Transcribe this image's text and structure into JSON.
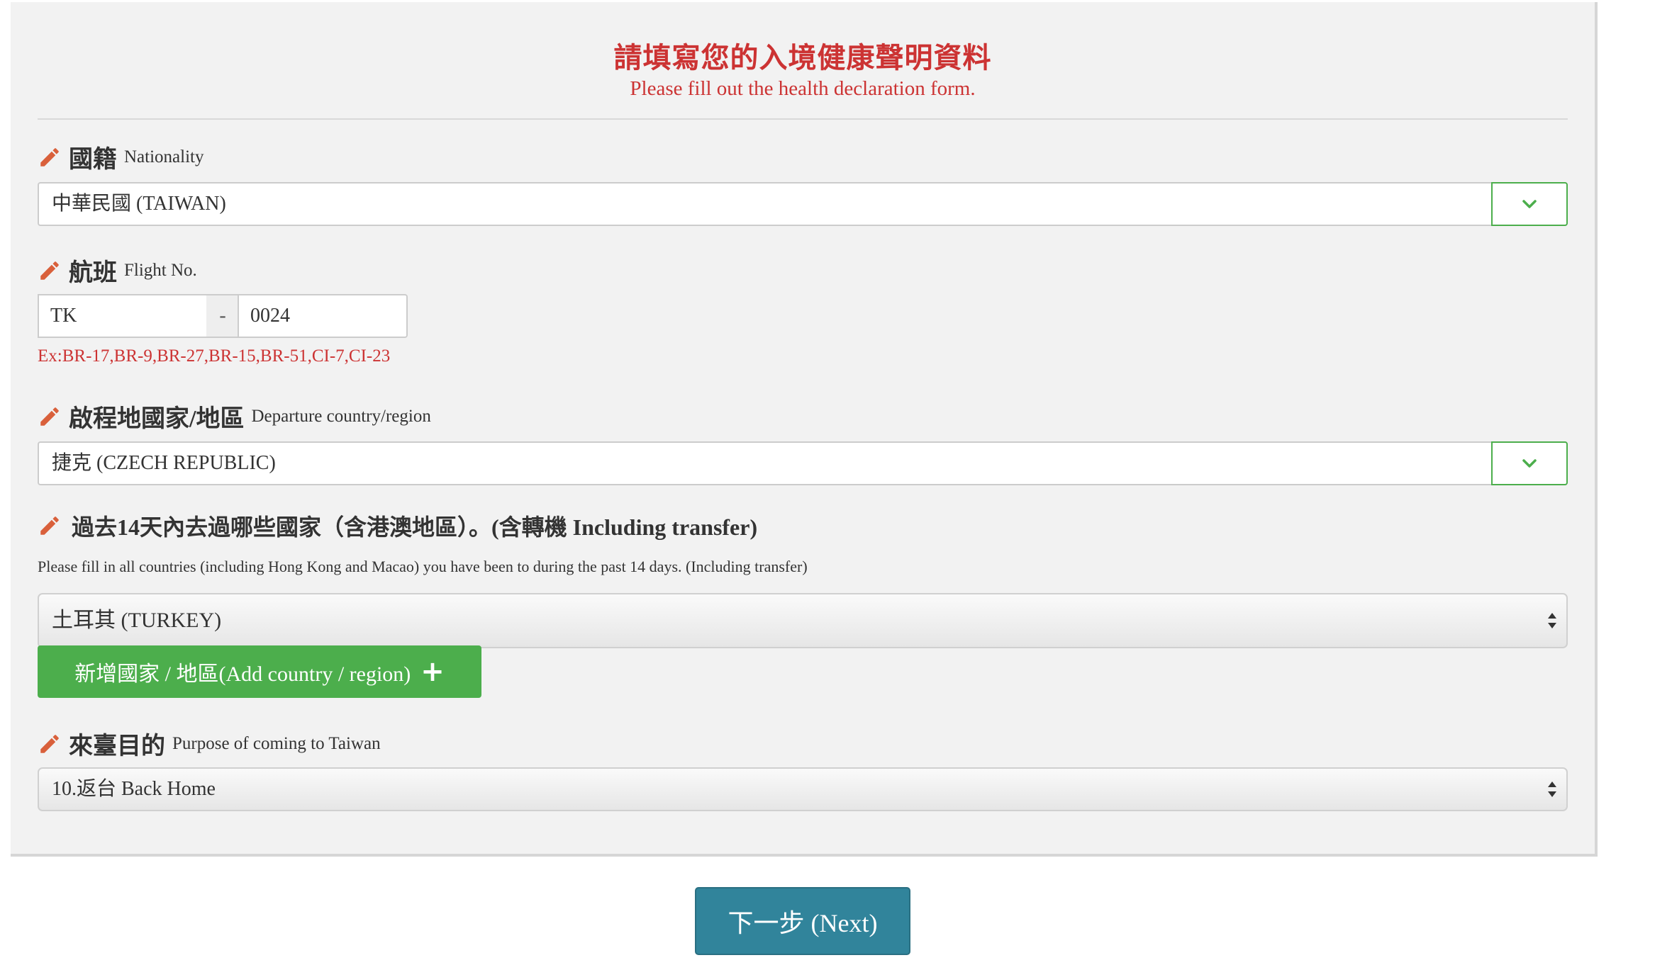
{
  "header": {
    "title_zh": "請填寫您的入境健康聲明資料",
    "title_en": "Please fill out the health declaration form."
  },
  "nationality": {
    "label_zh": "國籍",
    "label_en": "Nationality",
    "value": "中華民國 (TAIWAN)",
    "icon": "chevron-down-icon"
  },
  "flight": {
    "label_zh": "航班",
    "label_en": "Flight No.",
    "airline_code": "TK",
    "separator": "-",
    "number": "0024",
    "example": "Ex:BR-17,BR-9,BR-27,BR-15,BR-51,CI-7,CI-23"
  },
  "departure": {
    "label_zh": "啟程地國家/地區",
    "label_en": "Departure country/region",
    "value": "捷克 (CZECH REPUBLIC)",
    "icon": "chevron-down-icon"
  },
  "visited": {
    "label": "過去14天內去過哪些國家（含港澳地區）。(含轉機 Including transfer)",
    "hint": "Please fill in all countries (including Hong Kong and Macao) you have been to during the past 14 days. (Including transfer)",
    "value": "土耳其 (TURKEY)",
    "add_button": "新增國家 / 地區(Add country / region)",
    "add_icon": "plus-icon"
  },
  "purpose": {
    "label_zh": "來臺目的",
    "label_en": "Purpose of coming to Taiwan",
    "value": "10.返台 Back Home"
  },
  "next_button": "下一步 (Next)",
  "colors": {
    "accent_red": "#cc3333",
    "pencil": "#d9603b",
    "green": "#4cae4c",
    "next_teal": "#31849b",
    "panel_bg": "#f2f2f2"
  }
}
